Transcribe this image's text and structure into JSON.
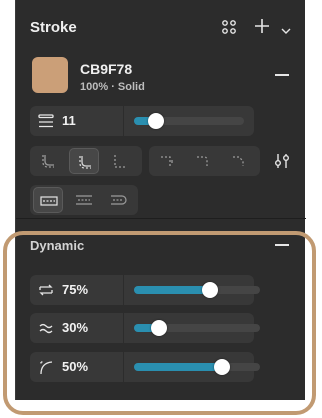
{
  "stroke": {
    "title": "Stroke",
    "icons": [
      "grid-dots-icon",
      "plus-icon",
      "chevron-down-icon"
    ],
    "color": {
      "swatch_color": "#CB9F78",
      "hex": "CB9F78",
      "subtitle": "100% · Solid"
    },
    "weight": {
      "value": "11",
      "slider_fraction": 0.2
    },
    "join_icons": [
      "join-round-icon",
      "join-miter-icon",
      "join-bevel-icon"
    ],
    "cap_icons": [
      "cap-round-icon",
      "cap-square-icon",
      "cap-butt-icon"
    ],
    "dash_icons": [
      "dash-none-icon",
      "dash-square-icon",
      "dash-round-icon"
    ]
  },
  "dynamic": {
    "title": "Dynamic",
    "rows": [
      {
        "icon": "frequency-icon",
        "value": "75%",
        "fraction": 0.6
      },
      {
        "icon": "wiggle-icon",
        "value": "30%",
        "fraction": 0.2
      },
      {
        "icon": "smoothing-icon",
        "value": "50%",
        "fraction": 0.7
      }
    ]
  },
  "colors": {
    "accent": "#2A8FB0",
    "panel": "#2C2C2C",
    "highlight": "#C19A72"
  }
}
